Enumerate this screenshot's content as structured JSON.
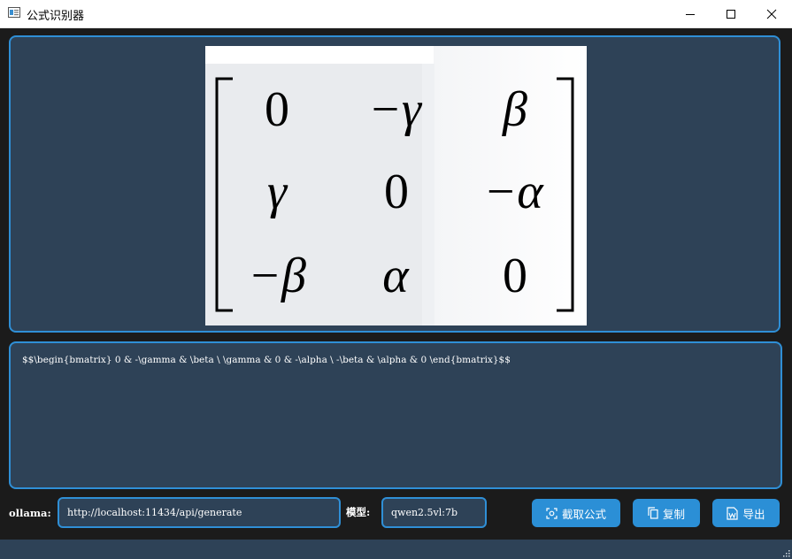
{
  "window": {
    "title": "公式识别器",
    "controls": {
      "minimize_icon": "minimize-icon",
      "maximize_icon": "maximize-icon",
      "close_icon": "close-icon"
    }
  },
  "image_panel": {
    "matrix": [
      [
        "0",
        "−γ",
        "β"
      ],
      [
        "γ",
        "0",
        "−α"
      ],
      [
        "−β",
        "α",
        "0"
      ]
    ]
  },
  "latex_panel": {
    "text": "$$\\begin{bmatrix} 0 & -\\gamma & \\beta \\ \\gamma & 0 & -\\alpha \\ -\\beta & \\alpha & 0 \\end{bmatrix}$$"
  },
  "controls": {
    "ollama_label": "ollama:",
    "ollama_url": "http://localhost:11434/api/generate",
    "model_label": "模型:",
    "model_name": "qwen2.5vl:7b",
    "capture_label": "截取公式",
    "copy_label": "复制",
    "export_label": "导出"
  },
  "colors": {
    "panel_bg": "#2e4257",
    "accent_border": "#2f8fd6",
    "button_bg": "#2b8fd6",
    "window_bg": "#1b1b1b"
  }
}
